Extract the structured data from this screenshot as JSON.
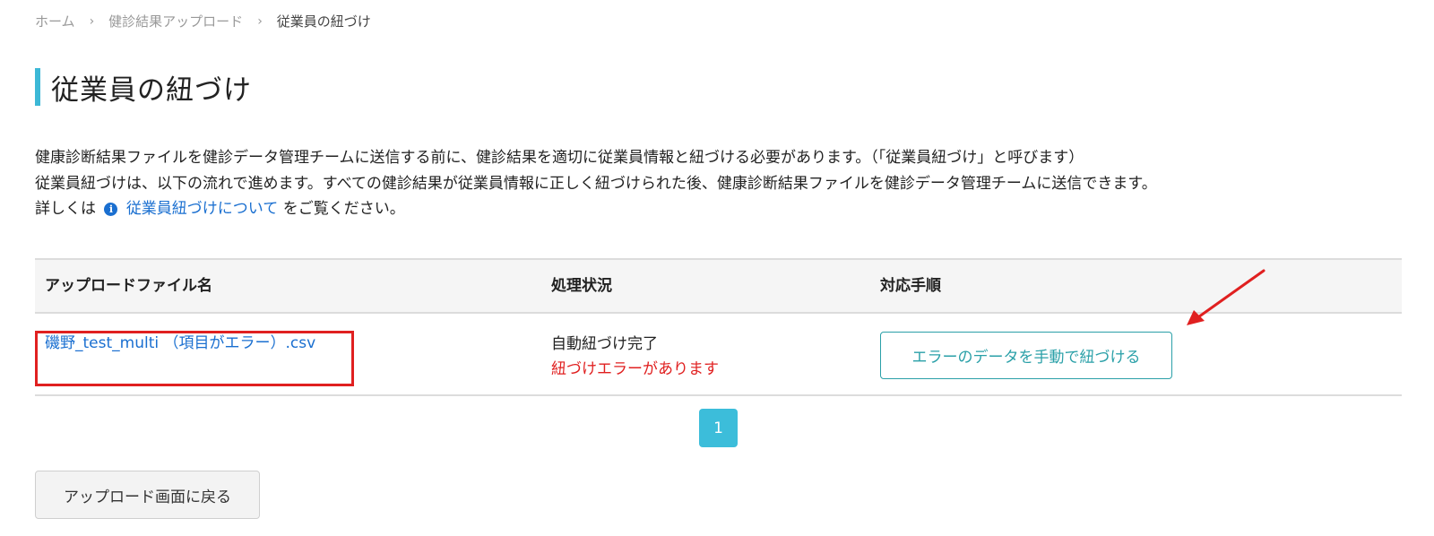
{
  "breadcrumb": {
    "home": "ホーム",
    "upload": "健診結果アップロード",
    "current": "従業員の紐づけ",
    "separator": "›"
  },
  "page_title": "従業員の紐づけ",
  "description": {
    "line1": "健康診断結果ファイルを健診データ管理チームに送信する前に、健診結果を適切に従業員情報と紐づける必要があります。（「従業員紐づけ」と呼びます）",
    "line2": "従業員紐づけは、以下の流れで進めます。すべての健診結果が従業員情報に正しく紐づけられた後、健康診断結果ファイルを健診データ管理チームに送信できます。",
    "line3_prefix": "詳しくは",
    "info_icon": "i",
    "link_text": "従業員紐づけについて",
    "line3_suffix": "をご覧ください。"
  },
  "table": {
    "headers": {
      "file_name": "アップロードファイル名",
      "status": "処理状況",
      "action": "対応手順"
    },
    "rows": [
      {
        "file_name": "磯野_test_multi （項目がエラー）.csv",
        "status": "自動紐づけ完了",
        "status_error": "紐づけエラーがあります",
        "action_label": "エラーのデータを手動で紐づける"
      }
    ]
  },
  "pagination": {
    "current_page": "1"
  },
  "back_button": "アップロード画面に戻る",
  "colors": {
    "accent": "#3cb8d6",
    "link": "#1a6fd0",
    "error": "#e02020",
    "button_teal": "#2aa0a8",
    "annotation_red": "#e02020"
  }
}
